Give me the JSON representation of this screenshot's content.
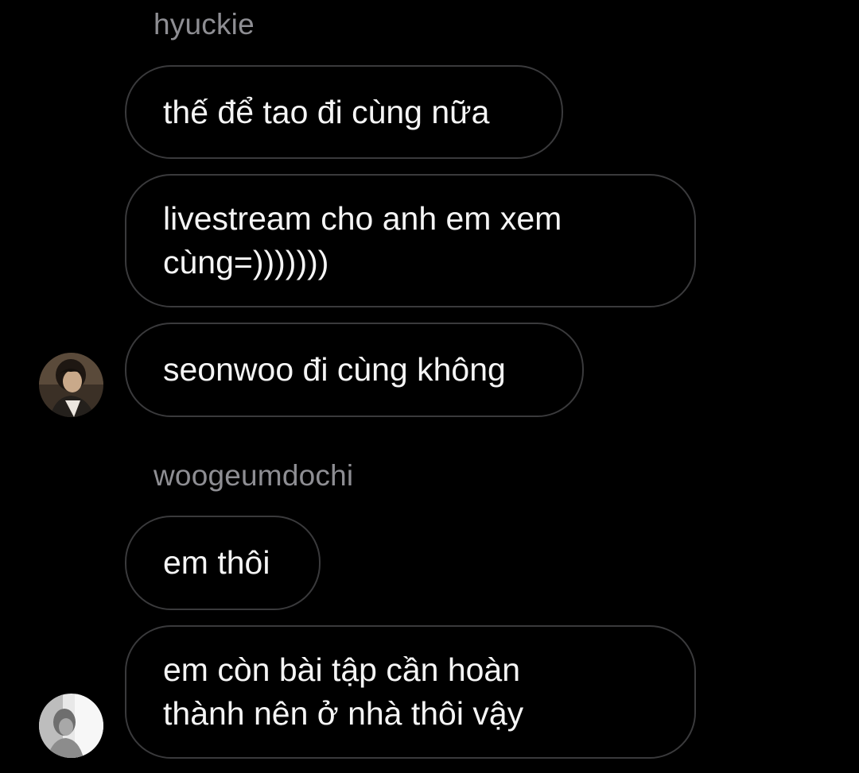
{
  "groups": [
    {
      "sender": "hyuckie",
      "messages": [
        "thế để tao đi cùng nữa",
        "livestream cho anh em xem\ncùng=)))))))",
        "seonwoo đi cùng không"
      ],
      "avatar_icon": "user-avatar-photo"
    },
    {
      "sender": "woogeumdochi",
      "messages": [
        "em thôi",
        "em còn bài tập cần hoàn\nthành nên ở nhà thôi vậy"
      ],
      "avatar_icon": "user-avatar-photo"
    }
  ],
  "colors": {
    "background": "#000000",
    "bubble_border": "#3a3a3c",
    "text": "#f5f5f5",
    "sender_name": "#8e8e93"
  }
}
